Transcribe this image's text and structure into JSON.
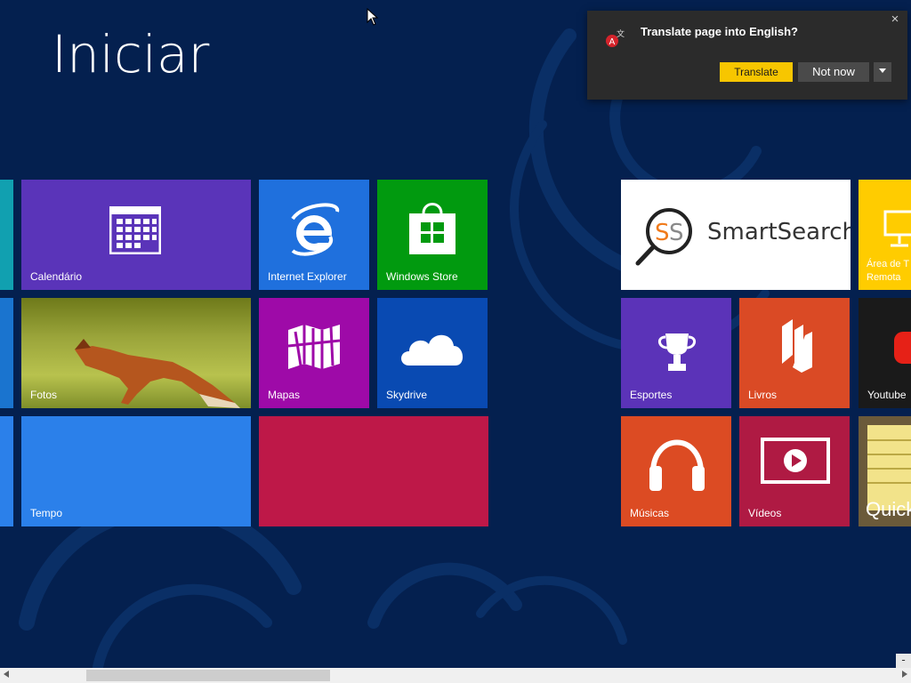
{
  "start": {
    "title": "Iniciar"
  },
  "tiles": {
    "calendario": "Calendário",
    "internet_explorer": "Internet Explorer",
    "windows_store": "Windows Store",
    "fotos": "Fotos",
    "mapas": "Mapas",
    "skydrive": "Skydrive",
    "tempo": "Tempo",
    "smartsearch": "SmartSearch",
    "area_remota_line1": "Área de T",
    "area_remota_line2": "Remota",
    "esportes": "Esportes",
    "livros": "Livros",
    "youtube": "Youtube",
    "musicas": "Músicas",
    "videos": "Vídeos",
    "quick": "Quick"
  },
  "translate_popup": {
    "title": "Translate page into English?",
    "translate_label": "Translate",
    "not_now_label": "Not now",
    "more_icon": "chevron-down-icon",
    "close_glyph": "×"
  },
  "scrollbar": {
    "minus_label": "-"
  },
  "colors": {
    "background": "#04204f",
    "calendar": "#5a34b9",
    "ie": "#1f70dd",
    "store": "#019a0f",
    "mapas": "#9e0aa8",
    "skydrive": "#094ab2",
    "tempo": "#2b80ea",
    "red": "#be1848",
    "smartsearch": "#ffffff",
    "esportes": "#5b33b8",
    "livros": "#da4a25",
    "videos": "#af1a43",
    "musicas": "#dc4b23",
    "yellow": "#ffcc00",
    "translate_button": "#f7c600"
  }
}
